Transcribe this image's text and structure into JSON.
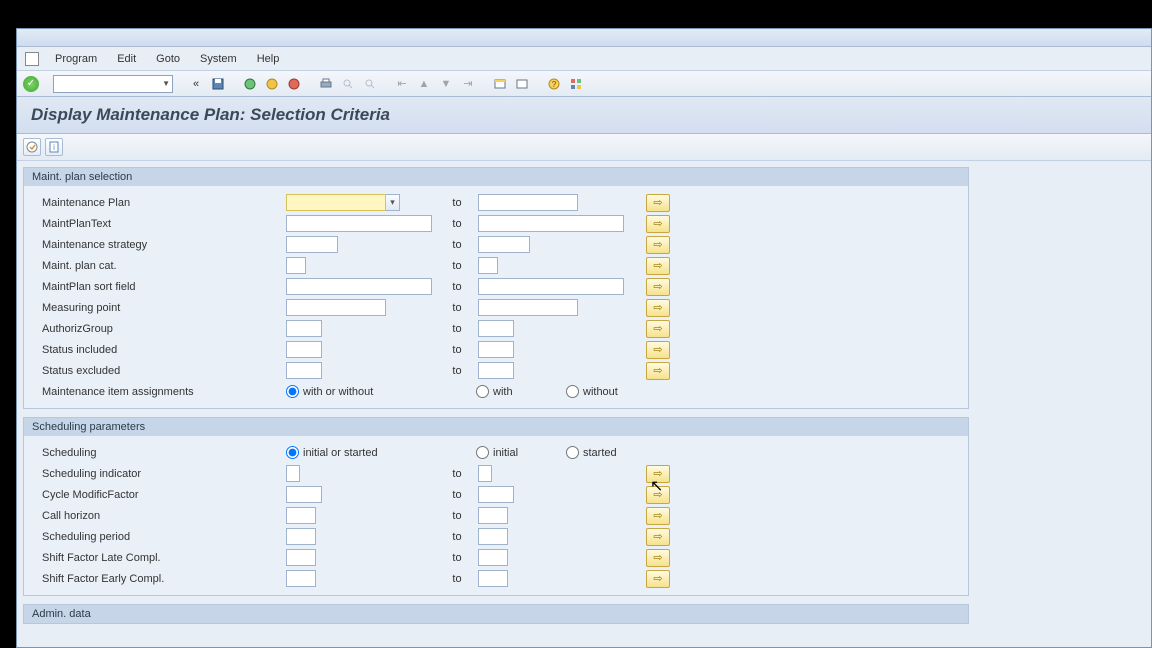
{
  "window": {
    "menus": [
      "Program",
      "Edit",
      "Goto",
      "System",
      "Help"
    ]
  },
  "page_title": "Display Maintenance Plan: Selection Criteria",
  "labels": {
    "to": "to"
  },
  "group1": {
    "title": "Maint. plan selection",
    "rows": {
      "maint_plan": "Maintenance Plan",
      "maint_plan_text": "MaintPlanText",
      "maint_strategy": "Maintenance strategy",
      "maint_plan_cat": "Maint. plan cat.",
      "sort_field": "MaintPlan sort field",
      "measuring_point": "Measuring point",
      "authoriz_group": "AuthorizGroup",
      "status_included": "Status included",
      "status_excluded": "Status excluded",
      "item_assign": "Maintenance item assignments"
    },
    "radios": {
      "opt1": "with or without",
      "opt2": "with",
      "opt3": "without",
      "selected": "opt1"
    }
  },
  "group2": {
    "title": "Scheduling parameters",
    "rows": {
      "scheduling": "Scheduling",
      "sched_indicator": "Scheduling indicator",
      "cycle_modific": "Cycle ModificFactor",
      "call_horizon": "Call horizon",
      "sched_period": "Scheduling period",
      "shift_late": "Shift Factor Late Compl.",
      "shift_early": "Shift Factor Early Compl."
    },
    "radios": {
      "opt1": "initial or started",
      "opt2": "initial",
      "opt3": "started",
      "selected": "opt1"
    }
  },
  "group3": {
    "title": "Admin. data"
  },
  "values": {
    "maint_plan_from": "",
    "maint_plan_to": "",
    "maint_plan_text_from": "",
    "maint_plan_text_to": "",
    "maint_strategy_from": "",
    "maint_strategy_to": "",
    "maint_plan_cat_from": "",
    "maint_plan_cat_to": "",
    "sort_field_from": "",
    "sort_field_to": "",
    "measuring_point_from": "",
    "measuring_point_to": "",
    "authoriz_group_from": "",
    "authoriz_group_to": "",
    "status_included_from": "",
    "status_included_to": "",
    "status_excluded_from": "",
    "status_excluded_to": "",
    "sched_indicator_from": "",
    "sched_indicator_to": "",
    "cycle_modific_from": "",
    "cycle_modific_to": "",
    "call_horizon_from": "",
    "call_horizon_to": "",
    "sched_period_from": "",
    "sched_period_to": "",
    "shift_late_from": "",
    "shift_late_to": "",
    "shift_early_from": "",
    "shift_early_to": ""
  }
}
